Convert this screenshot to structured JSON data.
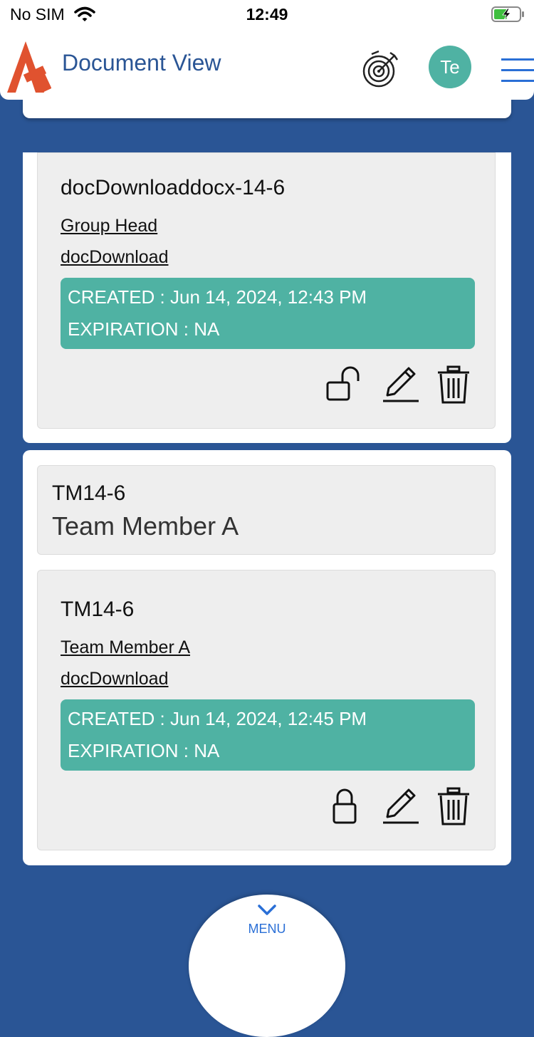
{
  "status_bar": {
    "carrier": "No SIM",
    "time": "12:49"
  },
  "header": {
    "title": "Document View",
    "avatar_initials": "Te"
  },
  "documents": [
    {
      "title": "docDownloaddocx-14-6",
      "owner_link": "Group Head",
      "type_link": "docDownload",
      "created": "CREATED : Jun 14, 2024, 12:43 PM",
      "expiration": "EXPIRATION : NA",
      "lock_state": "unlocked"
    },
    {
      "title": "TM14-6",
      "owner_link": "Team Member A",
      "type_link": "docDownload",
      "created": "CREATED : Jun 14, 2024, 12:45 PM",
      "expiration": "EXPIRATION : NA",
      "lock_state": "locked"
    }
  ],
  "group": {
    "title": "TM14-6",
    "subtitle": "Team Member A"
  },
  "bottom": {
    "menu_label": "MENU"
  },
  "colors": {
    "brand": "#2a5595",
    "accent": "#4fb2a3",
    "logo": "#e0522f"
  }
}
